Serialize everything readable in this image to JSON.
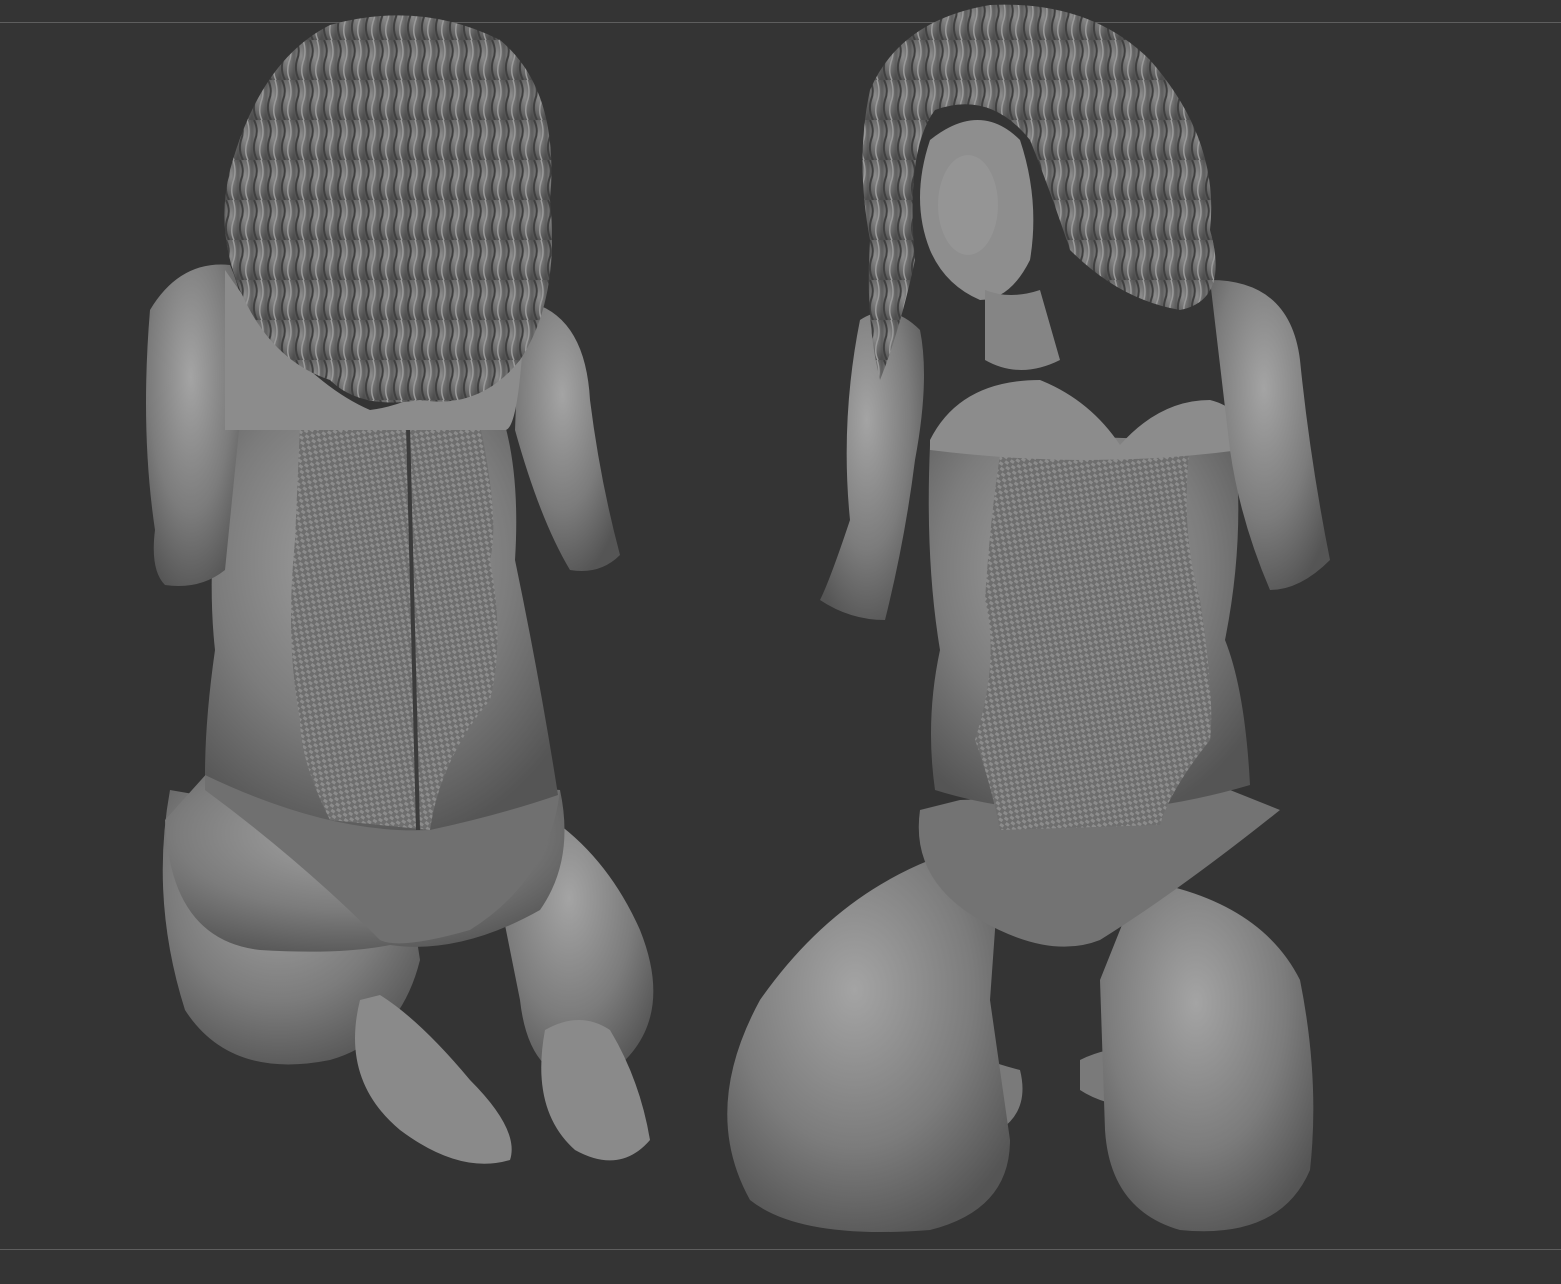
{
  "colors": {
    "background": "#343434",
    "guide_line": "#5e5e5e",
    "clay_light": "#9a9a9a",
    "clay_mid": "#7a7a7a",
    "clay_dark": "#505050",
    "mesh_pattern": "#8c8c8c"
  },
  "scene": {
    "description_icons": [
      "back-view-figure-icon",
      "front-view-figure-icon"
    ]
  }
}
